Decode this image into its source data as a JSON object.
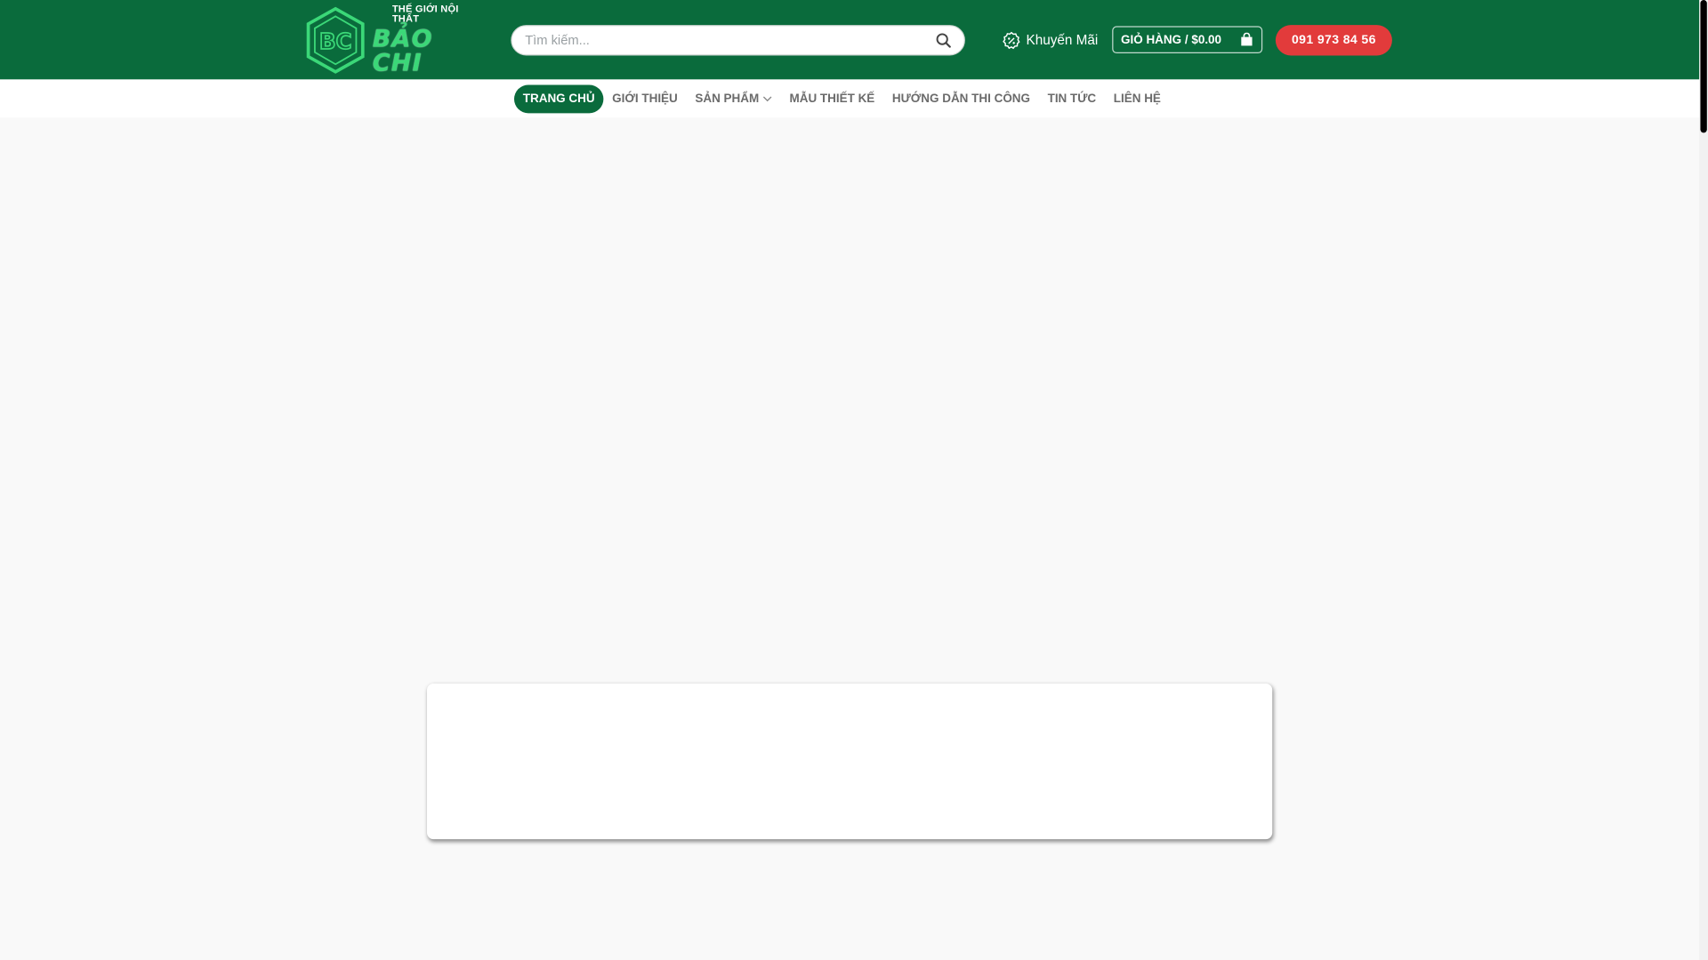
{
  "header": {
    "logo": {
      "small_text": "THẾ GIỚI NỘI THẤT",
      "big_text": "BẢO CHI",
      "mark_text": "BC"
    },
    "search": {
      "placeholder": "Tìm kiếm...",
      "icon": "search-icon"
    },
    "promo": {
      "label": "Khuyến Mãi",
      "icon": "discount-badge-icon"
    },
    "cart": {
      "label": "GIỎ HÀNG / $0.00",
      "icon": "shopping-bag-icon"
    },
    "phone": {
      "label": "091 973 84 56"
    }
  },
  "nav": {
    "items": [
      {
        "label": "TRANG CHỦ",
        "active": true
      },
      {
        "label": "GIỚI THIỆU",
        "active": false
      },
      {
        "label": "SẢN PHẨM",
        "active": false,
        "has_dropdown": true
      },
      {
        "label": "MẪU THIẾT KẾ",
        "active": false
      },
      {
        "label": "HƯỚNG DẪN THI CÔNG",
        "active": false
      },
      {
        "label": "TIN TỨC",
        "active": false
      },
      {
        "label": "LIÊN HỆ",
        "active": false
      }
    ]
  },
  "colors": {
    "header_green": "#0a6b3c",
    "logo_green": "#3bd878",
    "phone_red": "#e23b3b",
    "nav_text": "#6b6b6b",
    "page_bg": "#f9f9f9"
  }
}
